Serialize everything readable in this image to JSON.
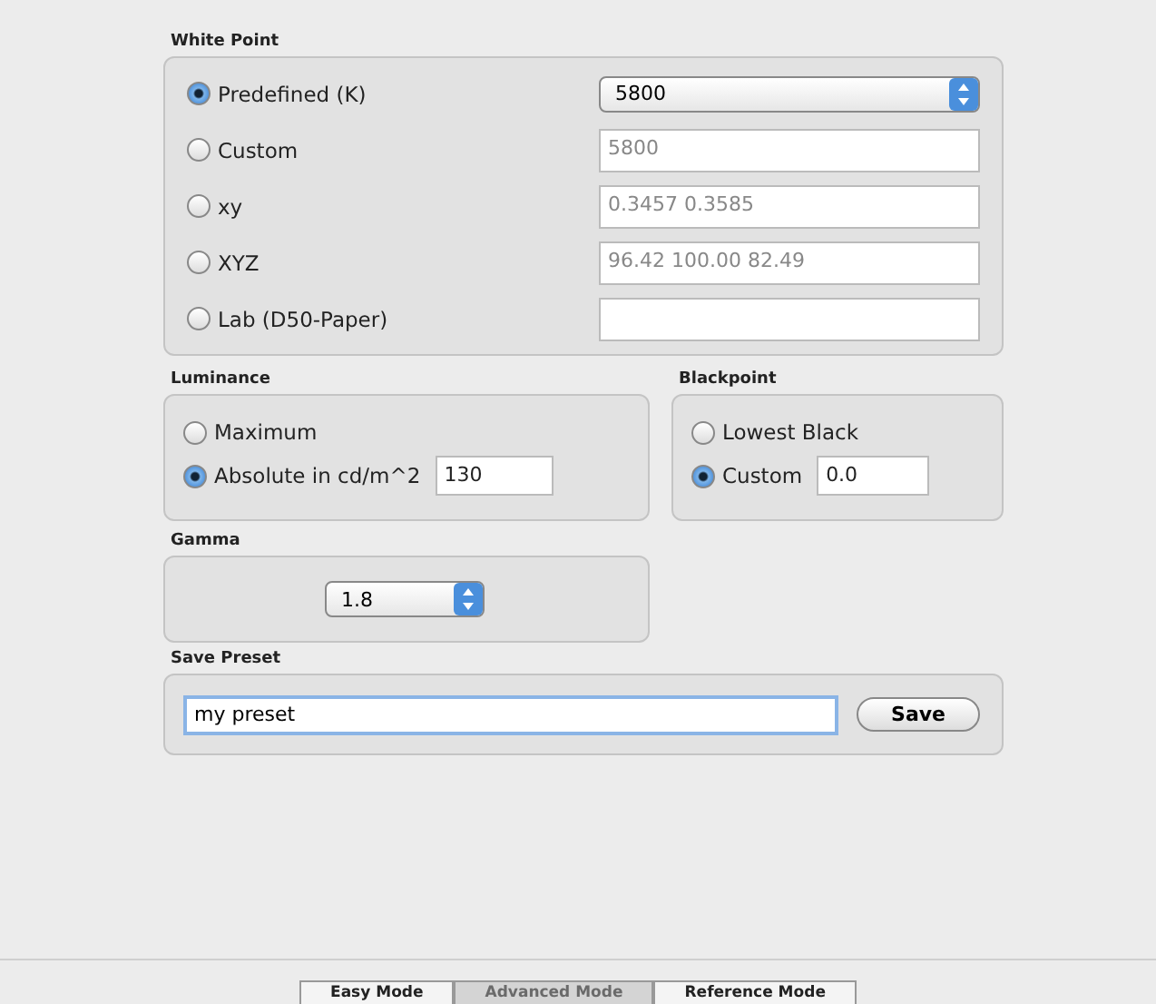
{
  "white_point": {
    "label": "White Point",
    "options": [
      {
        "label": "Predefined (K)",
        "selected": true,
        "kind": "select",
        "value": "5800"
      },
      {
        "label": "Custom",
        "selected": false,
        "kind": "field",
        "value": "5800"
      },
      {
        "label": "xy",
        "selected": false,
        "kind": "field",
        "value": "0.3457 0.3585"
      },
      {
        "label": "XYZ",
        "selected": false,
        "kind": "field",
        "value": "96.42 100.00 82.49"
      },
      {
        "label": "Lab (D50-Paper)",
        "selected": false,
        "kind": "field"
      }
    ]
  },
  "luminance": {
    "label": "Luminance",
    "options": [
      {
        "label": "Maximum",
        "selected": false
      },
      {
        "label": "Absolute in cd/m^2",
        "selected": true,
        "value": "130"
      }
    ]
  },
  "blackpoint": {
    "label": "Blackpoint",
    "options": [
      {
        "label": "Lowest Black",
        "selected": false
      },
      {
        "label": "Custom",
        "selected": true,
        "value": "0.0"
      }
    ]
  },
  "gamma": {
    "label": "Gamma",
    "value": "1.8"
  },
  "save_preset": {
    "label": "Save Preset",
    "value": "my preset",
    "button": "Save"
  },
  "mode_tabs": [
    {
      "label": "Easy Mode",
      "selected": false
    },
    {
      "label": "Advanced Mode",
      "selected": true
    },
    {
      "label": "Reference Mode",
      "selected": false
    }
  ]
}
